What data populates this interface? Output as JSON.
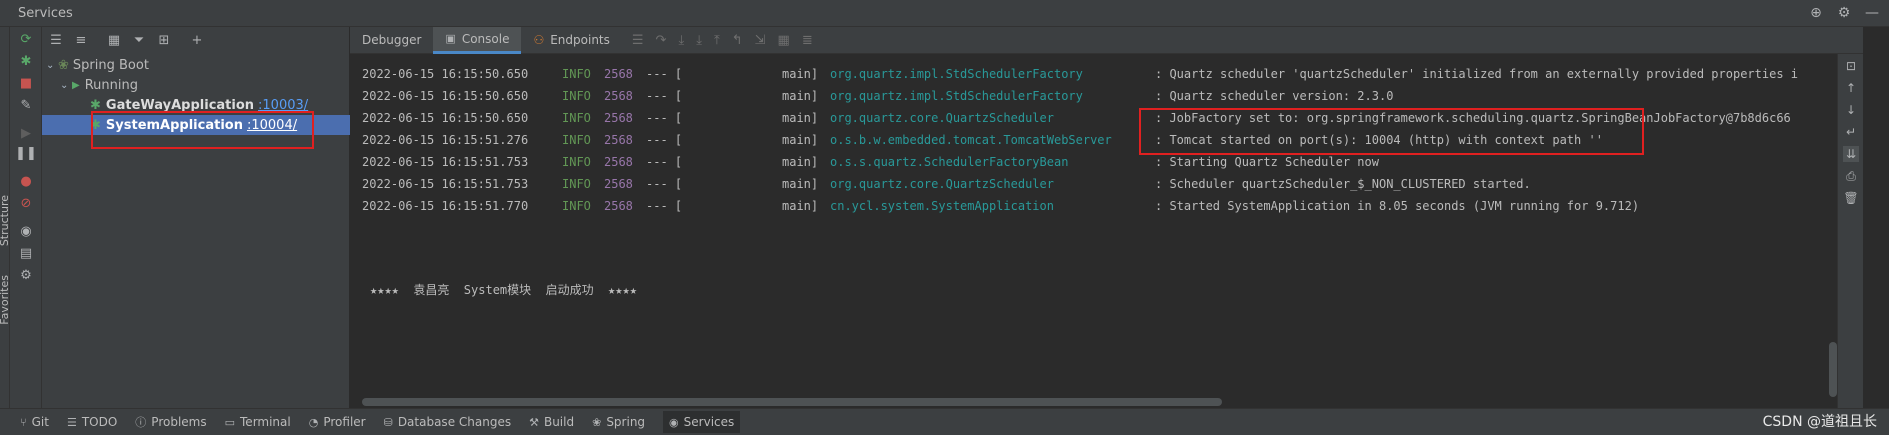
{
  "window": {
    "title": "Services"
  },
  "title_icons": [
    "crosshair-icon",
    "gear-icon",
    "minimize-icon"
  ],
  "tree": {
    "root": "Spring Boot",
    "group": "Running",
    "apps": [
      {
        "name": "GateWayApplication",
        "port": ":10003/"
      },
      {
        "name": "SystemApplication",
        "port": ":10004/"
      }
    ]
  },
  "tabs": [
    {
      "label": "Debugger"
    },
    {
      "label": "Console"
    },
    {
      "label": "Endpoints"
    }
  ],
  "left_vertical_tabs": [
    "Structure",
    "Favorites"
  ],
  "log": [
    {
      "ts": "2022-06-15 16:15:50.650",
      "level": "INFO",
      "pid": "2568",
      "sep": "--- [",
      "thread": "main]",
      "logger": "org.quartz.impl.StdSchedulerFactory",
      "msg": ": Quartz scheduler 'quartzScheduler' initialized from an externally provided properties i"
    },
    {
      "ts": "2022-06-15 16:15:50.650",
      "level": "INFO",
      "pid": "2568",
      "sep": "--- [",
      "thread": "main]",
      "logger": "org.quartz.impl.StdSchedulerFactory",
      "msg": ": Quartz scheduler version: 2.3.0"
    },
    {
      "ts": "2022-06-15 16:15:50.650",
      "level": "INFO",
      "pid": "2568",
      "sep": "--- [",
      "thread": "main]",
      "logger": "org.quartz.core.QuartzScheduler",
      "msg": ": JobFactory set to: org.springframework.scheduling.quartz.SpringBeanJobFactory@7b8d6c66"
    },
    {
      "ts": "2022-06-15 16:15:51.276",
      "level": "INFO",
      "pid": "2568",
      "sep": "--- [",
      "thread": "main]",
      "logger": "o.s.b.w.embedded.tomcat.TomcatWebServer",
      "msg": ": Tomcat started on port(s): 10004 (http) with context path ''"
    },
    {
      "ts": "2022-06-15 16:15:51.753",
      "level": "INFO",
      "pid": "2568",
      "sep": "--- [",
      "thread": "main]",
      "logger": "o.s.s.quartz.SchedulerFactoryBean",
      "msg": ": Starting Quartz Scheduler now"
    },
    {
      "ts": "2022-06-15 16:15:51.753",
      "level": "INFO",
      "pid": "2568",
      "sep": "--- [",
      "thread": "main]",
      "logger": "org.quartz.core.QuartzScheduler",
      "msg": ": Scheduler quartzScheduler_$_NON_CLUSTERED started."
    },
    {
      "ts": "2022-06-15 16:15:51.770",
      "level": "INFO",
      "pid": "2568",
      "sep": "--- [",
      "thread": "main]",
      "logger": "cn.ycl.system.SystemApplication",
      "msg": ": Started SystemApplication in 8.05 seconds (JVM running for 9.712)"
    }
  ],
  "banner": "★★★★  袁昌亮  System模块  启动成功  ★★★★",
  "statusbar": [
    {
      "label": "Git",
      "icon": "git-icon"
    },
    {
      "label": "TODO",
      "icon": "list-icon"
    },
    {
      "label": "Problems",
      "icon": "info-icon"
    },
    {
      "label": "Terminal",
      "icon": "terminal-icon"
    },
    {
      "label": "Profiler",
      "icon": "profiler-icon"
    },
    {
      "label": "Database Changes",
      "icon": "database-icon"
    },
    {
      "label": "Build",
      "icon": "hammer-icon"
    },
    {
      "label": "Spring",
      "icon": "spring-icon"
    },
    {
      "label": "Services",
      "icon": "services-icon"
    }
  ],
  "watermark": "CSDN @道祖且长",
  "colors": {
    "selection": "#4b6eaf",
    "logger": "#299999",
    "info": "#629755",
    "pid": "#9876aa",
    "highlight": "#e02020"
  }
}
